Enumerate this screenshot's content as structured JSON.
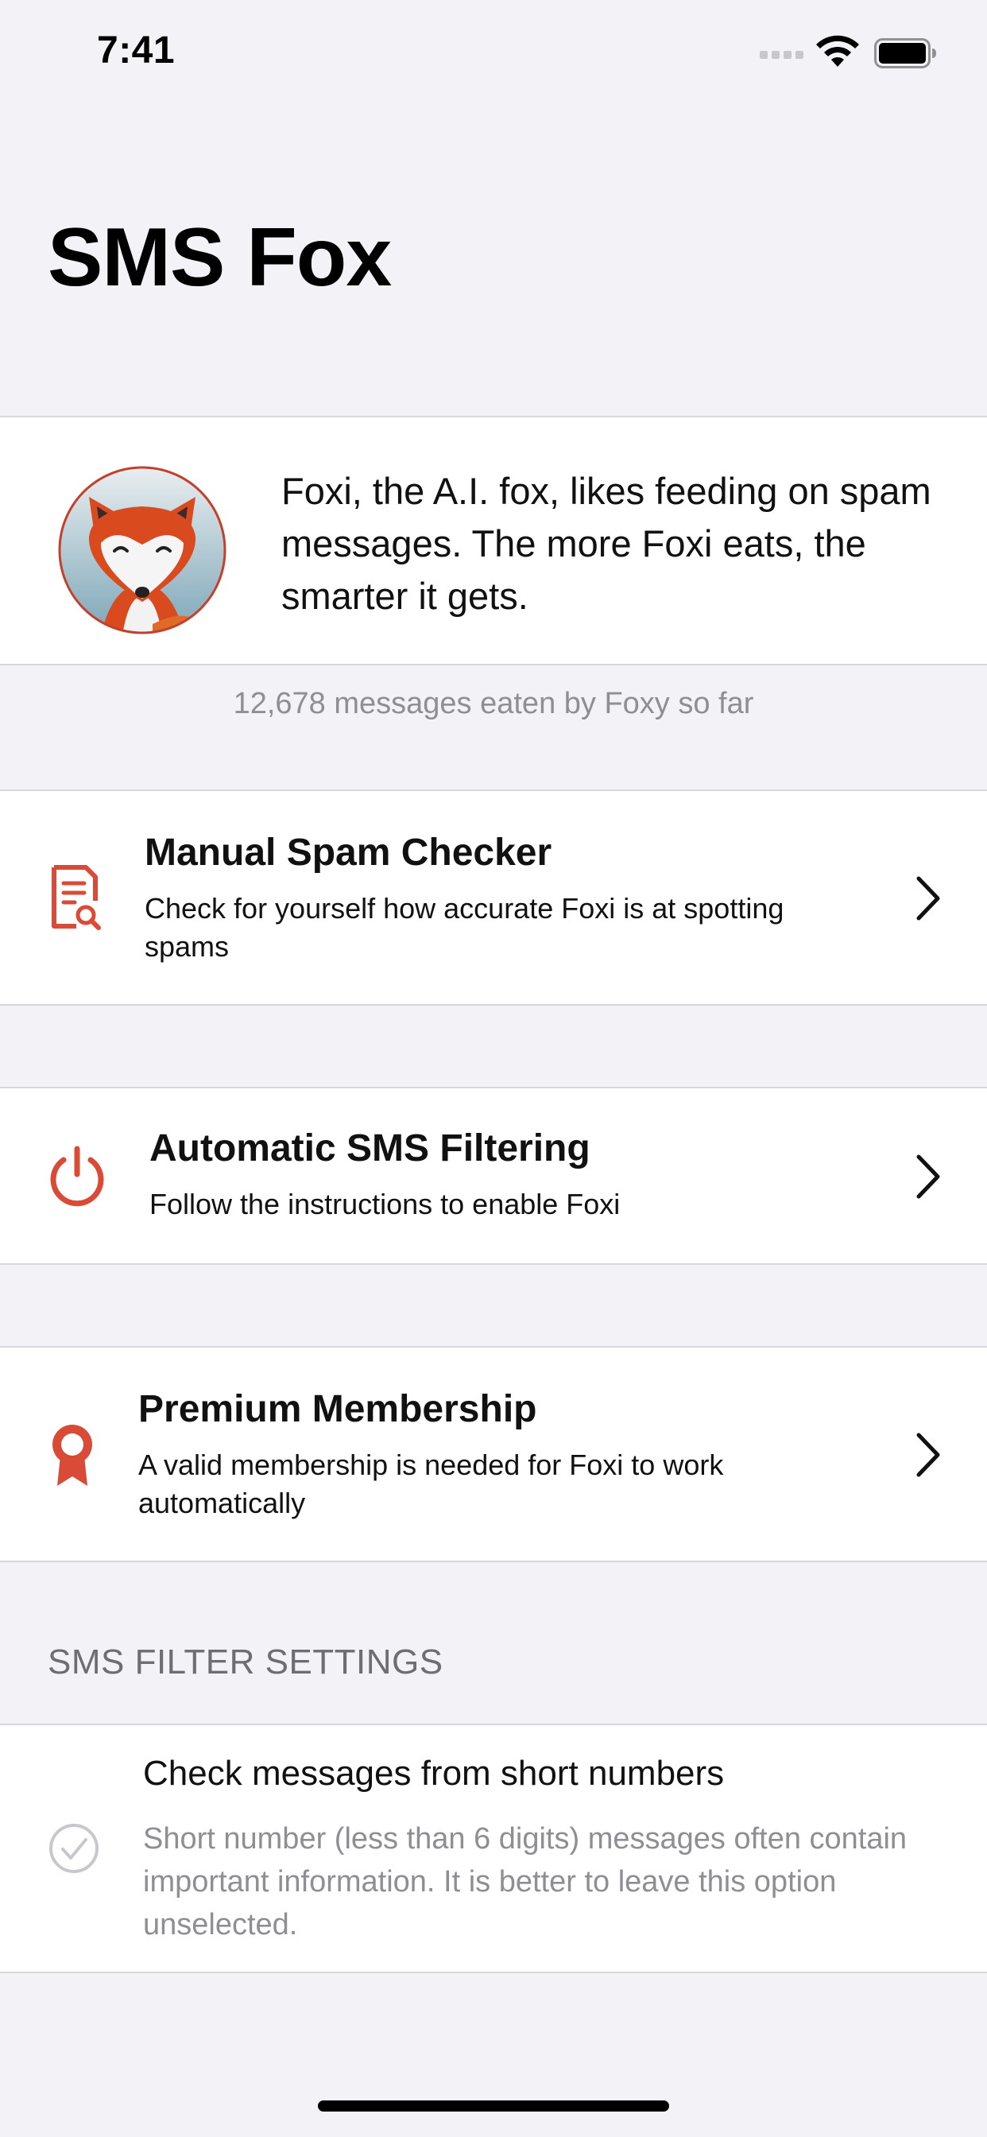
{
  "status_bar": {
    "time": "7:41"
  },
  "app": {
    "title": "SMS Fox"
  },
  "intro": {
    "text": "Foxi, the A.I. fox, likes feeding on spam messages. The more Foxi eats, the smarter it gets."
  },
  "stats": {
    "messages_eaten_text": "12,678 messages eaten by Foxy so far"
  },
  "menu": {
    "manual": {
      "title": "Manual Spam Checker",
      "subtitle": "Check for yourself how accurate Foxi is at spotting spams",
      "icon": "document-search-icon"
    },
    "automatic": {
      "title": "Automatic SMS Filtering",
      "subtitle": "Follow the instructions to enable Foxi",
      "icon": "power-icon"
    },
    "premium": {
      "title": "Premium Membership",
      "subtitle": "A valid membership is needed for Foxi to work automatically",
      "icon": "ribbon-badge-icon"
    }
  },
  "settings": {
    "header": "SMS FILTER SETTINGS",
    "short_numbers": {
      "title": "Check messages from short numbers",
      "description": "Short number (less than 6 digits) messages often contain important information. It is better to leave this option unselected.",
      "selected": false
    }
  },
  "colors": {
    "accent": "#d94b36",
    "background": "#f2f2f7",
    "secondary_text": "#8e8e93"
  }
}
